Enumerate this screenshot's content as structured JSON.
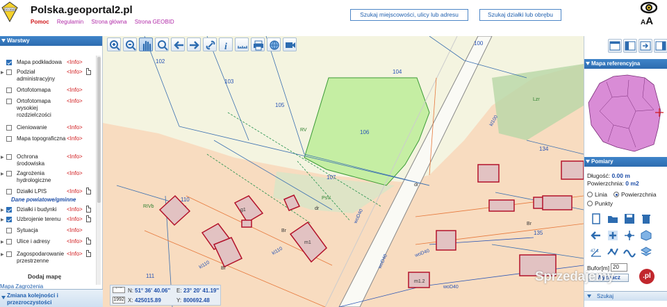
{
  "header": {
    "site_title": "Polska.geoportal2.pl",
    "logo_text": "GEOBID",
    "links": [
      "Pomoc",
      "Regulamin",
      "Strona główna",
      "Strona GEOBID"
    ],
    "search_place_label": "Szukaj miejscowości, ulicy lub adresu",
    "search_parcel_label": "Szukaj działki lub obrębu",
    "font_size_label_small": "A",
    "font_size_label_big": "A"
  },
  "layers_panel": {
    "title": "Warstwy",
    "items": [
      {
        "label": "Mapa podkładowa",
        "info": "<Info>",
        "checked": true
      },
      {
        "label": "Podział administracyjny",
        "info": "<Info>",
        "checked": false
      },
      {
        "label": "Ortofotomapa",
        "info": "<Info>",
        "checked": false
      },
      {
        "label": "Ortofotomapa wysokiej rozdzielczości",
        "info": "<Info>",
        "checked": false
      },
      {
        "label": "Cieniowanie",
        "info": "<Info>",
        "checked": false
      },
      {
        "label": "Mapa topograficzna",
        "info": "<Info>",
        "checked": false
      },
      {
        "label": "Ochrona środowiska",
        "info": "<Info>",
        "checked": false
      },
      {
        "label": "Zagrożenia hydrologiczne",
        "info": "<Info>",
        "checked": false
      },
      {
        "label": "Działki LPIS",
        "info": "<Info>",
        "checked": false
      },
      {
        "label": "Działki i budynki",
        "info": "<Info>",
        "checked": true
      },
      {
        "label": "Uzbrojenie terenu",
        "info": "<Info>",
        "checked": true
      },
      {
        "label": "Sytuacja",
        "info": "<Info>",
        "checked": false
      },
      {
        "label": "Ulice i adresy",
        "info": "<Info>",
        "checked": false
      },
      {
        "label": "Zagospodarowanie przestrzenne",
        "info": "<Info>",
        "checked": false
      }
    ],
    "group_label": "Dane powiatowe/gminne",
    "add_map_label": "Dodaj mapę",
    "map_changes_label": "Mapa Zagrożenia",
    "order_label": "Zmiana kolejności i przezroczystości"
  },
  "coordinates": {
    "format_label": "° ' ''",
    "system_label": "1992",
    "n_label": "N:",
    "n_value": "51° 36' 40.06''",
    "e_label": "E:",
    "e_value": "23° 20' 41.19''",
    "x_label": "X:",
    "x_value": "425015.89",
    "y_label": "Y:",
    "y_value": "800692.48"
  },
  "map": {
    "parcels": [
      "102",
      "103",
      "104",
      "105",
      "106",
      "107",
      "100",
      "110",
      "111",
      "134",
      "135"
    ],
    "labels": {
      "rv1": "RV",
      "rv2": "RV",
      "psv": "PsV",
      "rivb": "RIVb",
      "lzr": "Lzr",
      "dr1": "dr",
      "dr2": "dr",
      "br1": "Br",
      "br2": "Br",
      "br3": "Br",
      "g1": "g1",
      "m1": "m1",
      "m12": "m1.2",
      "wod1": "woD40",
      "wod2": "woD40",
      "wod3": "woD40",
      "wod4": "woD40",
      "kl1": "kl110",
      "kl2": "kl110",
      "kl3": "kl100"
    }
  },
  "right_panel": {
    "refmap_title": "Mapa referencyjna",
    "measure_title": "Pomiary",
    "length_label": "Długość:",
    "length_value": "0.00 m",
    "area_label": "Powierzchnia:",
    "area_value": "0 m2",
    "radio_line": "Linia",
    "radio_area": "Powierzchnia",
    "radio_points": "Punkty",
    "buffer_label": "Bufor[m]",
    "buffer_value": "20",
    "calc_label": "Wyznacz",
    "search_label": "Szukaj"
  },
  "watermark": {
    "text": "Sprzedajemy",
    "badge": ".pl"
  },
  "colors": {
    "accent": "#2d6cb0",
    "info": "#d0181b",
    "parcel_fill": "#c5eea3",
    "building_fill": "#e2c2c2"
  }
}
